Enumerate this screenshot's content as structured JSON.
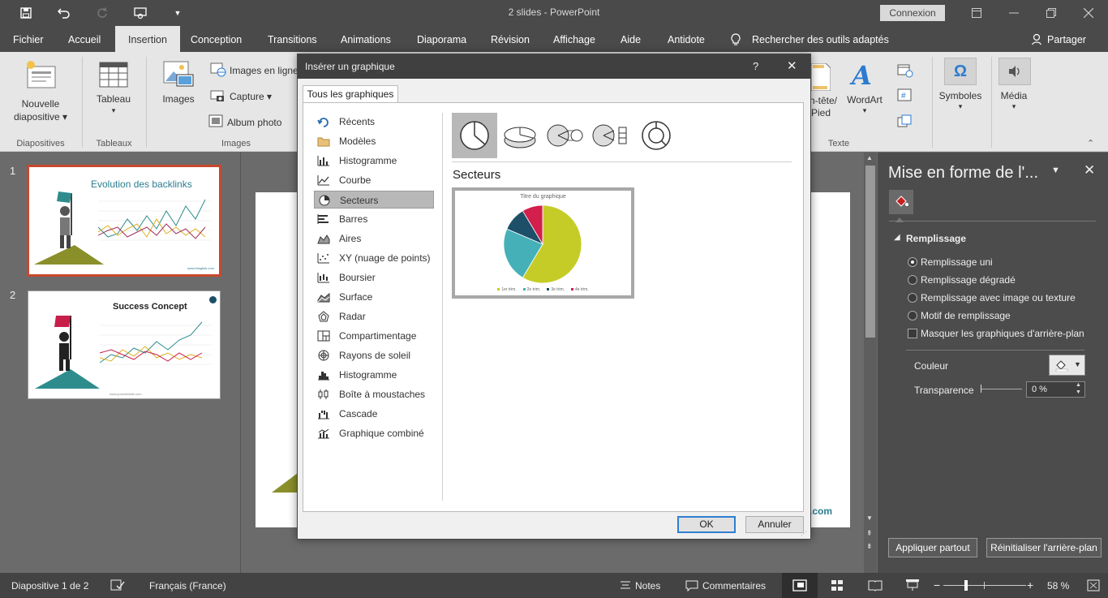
{
  "app": {
    "doc_title": "2 slides",
    "app_name": "PowerPoint",
    "title_separator": " - ",
    "signin_label": "Connexion"
  },
  "ribbon_tabs": [
    {
      "label": "Fichier"
    },
    {
      "label": "Accueil"
    },
    {
      "label": "Insertion",
      "active": true
    },
    {
      "label": "Conception"
    },
    {
      "label": "Transitions"
    },
    {
      "label": "Animations"
    },
    {
      "label": "Diaporama"
    },
    {
      "label": "Révision"
    },
    {
      "label": "Affichage"
    },
    {
      "label": "Aide"
    },
    {
      "label": "Antidote"
    }
  ],
  "tell_me": "Rechercher des outils adaptés",
  "share_label": "Partager",
  "ribbon": {
    "new_slide_line1": "Nouvelle",
    "new_slide_line2": "diapositive",
    "table": "Tableau",
    "images": "Images",
    "online_images": "Images en ligne",
    "screenshot": "Capture",
    "photo_album": "Album photo",
    "header_footer_line1": "n-tête/",
    "header_footer_line2": "Pied",
    "wordart": "WordArt",
    "symbols": "Symboles",
    "media": "Média",
    "groups": {
      "slides": "Diapositives",
      "tables": "Tableaux",
      "images": "Images",
      "text": "Texte"
    }
  },
  "slides": [
    {
      "number": "1",
      "title": "Evolution des backlinks",
      "footer": "www.thinglink.com"
    },
    {
      "number": "2",
      "title": "Success Concept",
      "footer": "www.yourwebsite.com"
    }
  ],
  "slide_canvas": {
    "footer_fragment": ".com"
  },
  "format_pane": {
    "title": "Mise en forme de l'...",
    "section": "Remplissage",
    "options": [
      {
        "label": "Remplissage uni",
        "checked": true
      },
      {
        "label": "Remplissage dégradé",
        "checked": false
      },
      {
        "label": "Remplissage avec image ou texture",
        "checked": false
      },
      {
        "label": "Motif de remplissage",
        "checked": false
      }
    ],
    "hide_bg_label": "Masquer les graphiques d'arrière-plan",
    "color_label": "Couleur",
    "transparency_label": "Transparence",
    "transparency_value": "0 %",
    "apply_all": "Appliquer partout",
    "reset_bg": "Réinitialiser l'arrière-plan"
  },
  "status_bar": {
    "slide_info": "Diapositive 1 de 2",
    "language": "Français (France)",
    "notes": "Notes",
    "comments": "Commentaires",
    "zoom": "58 %"
  },
  "dialog": {
    "title": "Insérer un graphique",
    "help": "?",
    "tab_all": "Tous les graphiques",
    "categories": [
      {
        "label": "Récents",
        "icon": "recent-icon"
      },
      {
        "label": "Modèles",
        "icon": "folder-icon"
      },
      {
        "label": "Histogramme",
        "icon": "column-chart-icon"
      },
      {
        "label": "Courbe",
        "icon": "line-chart-icon"
      },
      {
        "label": "Secteurs",
        "icon": "pie-chart-icon",
        "selected": true
      },
      {
        "label": "Barres",
        "icon": "bar-chart-icon"
      },
      {
        "label": "Aires",
        "icon": "area-chart-icon"
      },
      {
        "label": "XY (nuage de points)",
        "icon": "scatter-chart-icon"
      },
      {
        "label": "Boursier",
        "icon": "stock-chart-icon"
      },
      {
        "label": "Surface",
        "icon": "surface-chart-icon"
      },
      {
        "label": "Radar",
        "icon": "radar-chart-icon"
      },
      {
        "label": "Compartimentage",
        "icon": "treemap-icon"
      },
      {
        "label": "Rayons de soleil",
        "icon": "sunburst-icon"
      },
      {
        "label": "Histogramme",
        "icon": "histogram-icon"
      },
      {
        "label": "Boîte à moustaches",
        "icon": "box-whisker-icon"
      },
      {
        "label": "Cascade",
        "icon": "waterfall-icon"
      },
      {
        "label": "Graphique combiné",
        "icon": "combo-chart-icon"
      }
    ],
    "selected_type_heading": "Secteurs",
    "preview_title": "Titre du graphique",
    "preview_legend": [
      "1er trim.",
      "2e trim.",
      "3e trim.",
      "4e trim."
    ],
    "ok": "OK",
    "cancel": "Annuler"
  },
  "chart_data": {
    "type": "pie",
    "title": "Titre du graphique",
    "categories": [
      "1er trim.",
      "2e trim.",
      "3e trim.",
      "4e trim."
    ],
    "values": [
      8.2,
      3.2,
      1.4,
      1.2
    ],
    "colors": [
      "#c5cc27",
      "#45b0b8",
      "#1d4f69",
      "#d21f4b"
    ]
  },
  "colors": {
    "accent_red": "#c8482d",
    "pie_1": "#c5cc27",
    "pie_2": "#45b0b8",
    "pie_3": "#1d4f69",
    "pie_4": "#d21f4b",
    "thumb_olive": "#8a8f2a",
    "thumb_teal": "#2e8c8c"
  }
}
